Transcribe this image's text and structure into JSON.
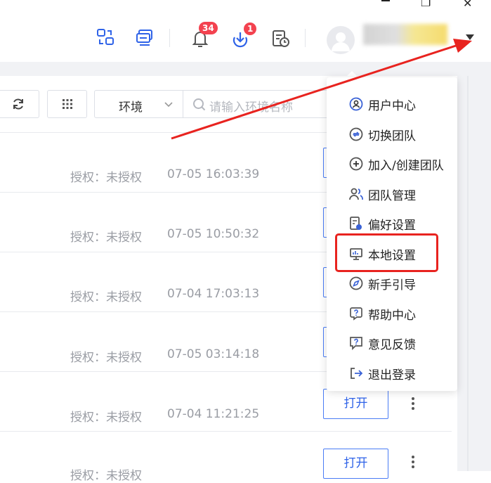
{
  "window": {
    "minimize": "",
    "maximize": "❐",
    "close": "✕"
  },
  "header": {
    "notification_count": "34",
    "download_count": "1"
  },
  "toolbar": {
    "env_label": "环境",
    "search_placeholder": "请输入环境名称"
  },
  "rows": [
    {
      "auth": "授权：未授权",
      "time": "07-05 16:03:39",
      "open": ""
    },
    {
      "auth": "授权：未授权",
      "time": "07-05 10:50:32",
      "open": ""
    },
    {
      "auth": "授权：未授权",
      "time": "07-04 17:03:13",
      "open": ""
    },
    {
      "auth": "授权：未授权",
      "time": "07-05 03:14:18",
      "open": ""
    },
    {
      "auth": "授权：未授权",
      "time": "07-04 11:21:25",
      "open": "打开"
    },
    {
      "auth": "授权：未授权",
      "time": "",
      "open": "打开"
    }
  ],
  "menu": {
    "items": [
      {
        "label": "用户中心",
        "icon": "user-circle-icon"
      },
      {
        "label": "切换团队",
        "icon": "switch-team-icon"
      },
      {
        "label": "加入/创建团队",
        "icon": "plus-circle-icon"
      },
      {
        "label": "团队管理",
        "icon": "team-users-icon"
      },
      {
        "label": "偏好设置",
        "icon": "preference-doc-icon"
      },
      {
        "label": "本地设置",
        "icon": "monitor-icon"
      },
      {
        "label": "新手引导",
        "icon": "compass-icon"
      },
      {
        "label": "帮助中心",
        "icon": "help-icon"
      },
      {
        "label": "意见反馈",
        "icon": "feedback-icon"
      },
      {
        "label": "退出登录",
        "icon": "logout-icon"
      }
    ]
  },
  "colors": {
    "accent": "#2f63e8",
    "badge": "#f3424f",
    "highlight": "#e8231f",
    "arrow": "#e8231f"
  }
}
